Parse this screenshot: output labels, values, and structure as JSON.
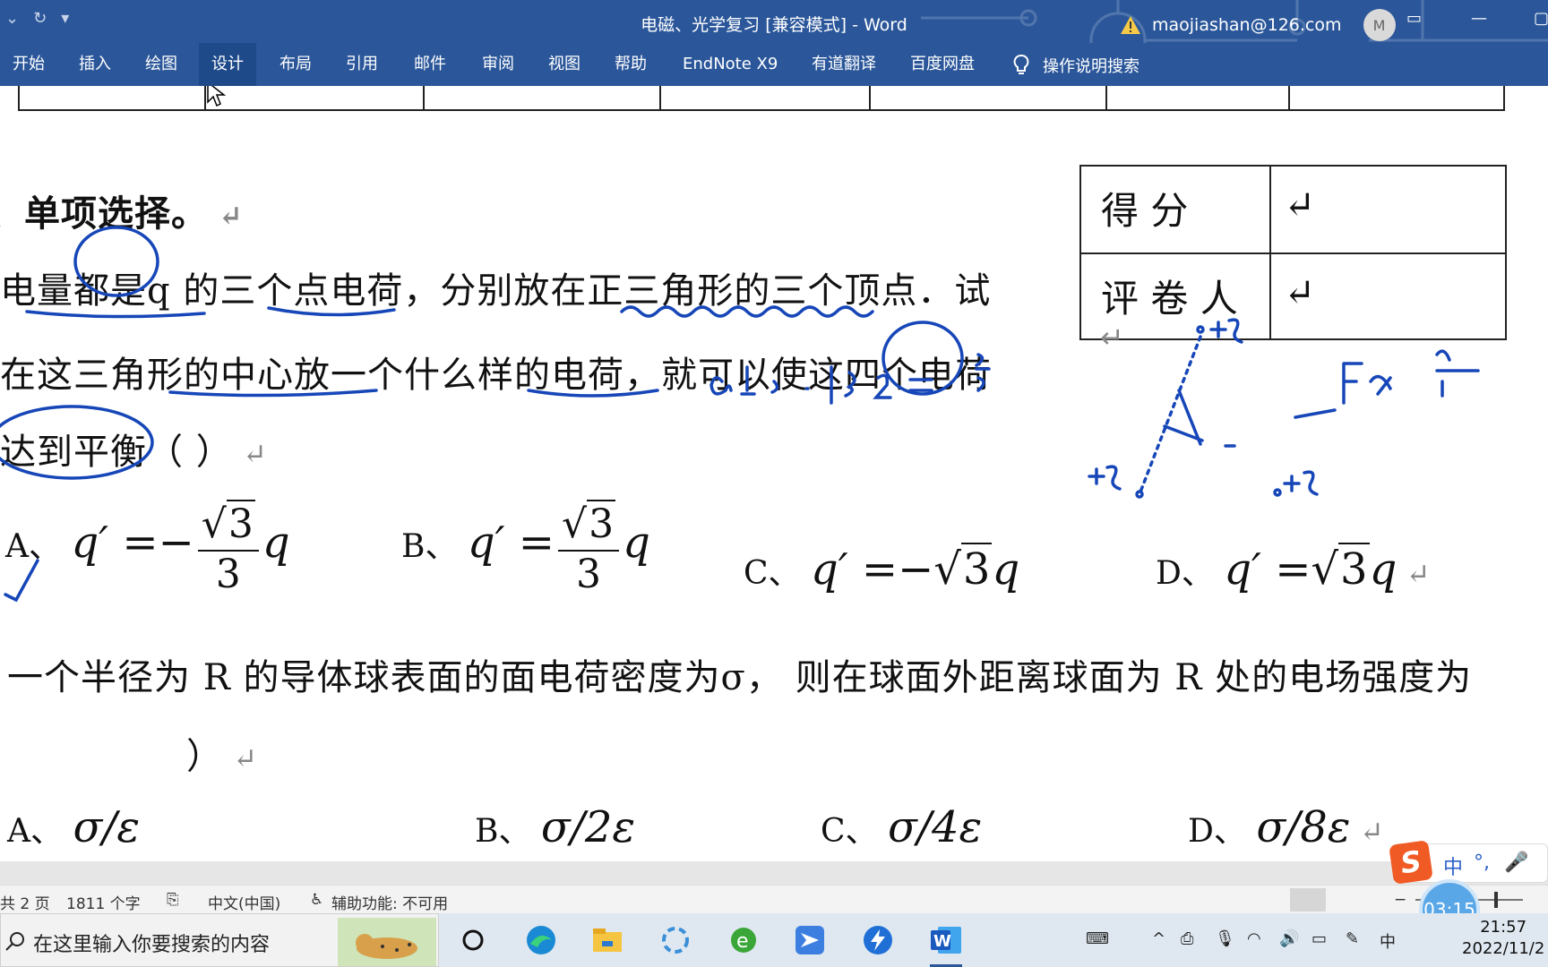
{
  "window": {
    "title": "电磁、光学复习 [兼容模式]  -  Word",
    "account_email": "maojiashan@126.com",
    "avatar_initial": "M"
  },
  "ribbon": {
    "tabs": [
      "开始",
      "插入",
      "绘图",
      "设计",
      "布局",
      "引用",
      "邮件",
      "审阅",
      "视图",
      "帮助",
      "EndNote X9",
      "有道翻译",
      "百度网盘"
    ],
    "active_tab": "设计",
    "tell_me": "操作说明搜索"
  },
  "document": {
    "section_heading": "、单项选择。",
    "q1": {
      "line1": "电量都是q 的三个点电荷，分别放在正三角形的三个顶点．试",
      "line2": "在这三角形的中心放一个什么样的电荷，就可以使这四个电荷",
      "line3": "达到平衡（          ）",
      "options": {
        "a_label": "A、",
        "b_label": "B、",
        "c_label": "C、",
        "d_label": "D、",
        "lhs": "q′ =",
        "neg": "−",
        "sqrt3": "3",
        "den": "3",
        "q": "q"
      }
    },
    "q2": {
      "line1": "一个半径为 R 的导体球表面的面电荷密度为σ， 则在球面外距离球面为 R 处的电场强度为",
      "line2": "）",
      "options": {
        "a_label": "A、",
        "b_label": "B、",
        "c_label": "C、",
        "d_label": "D、",
        "sigma": "σ",
        "a_den": "ε",
        "b_den": "2ε",
        "c_den": "4ε",
        "d_den": "8ε"
      }
    },
    "score_table": {
      "row1_label": "得    分",
      "row2_label": "评 卷 人"
    },
    "handwriting": {
      "calc": "a·½·1/√3·2 = √3/3 a",
      "charges": "+q",
      "minus": "-",
      "force": "F ∝ qq/r²"
    }
  },
  "statusbar": {
    "pages": "共 2 页",
    "words": "1811 个字",
    "language": "中文(中国)",
    "accessibility": "辅助功能: 不可用"
  },
  "taskbar": {
    "search_placeholder": "在这里输入你要搜索的内容",
    "time": "21:57",
    "date": "2022/11/2",
    "timer": "03:15",
    "ime_mode": "中"
  },
  "colors": {
    "word_blue": "#2b579a",
    "ink_blue": "#1646b8"
  }
}
